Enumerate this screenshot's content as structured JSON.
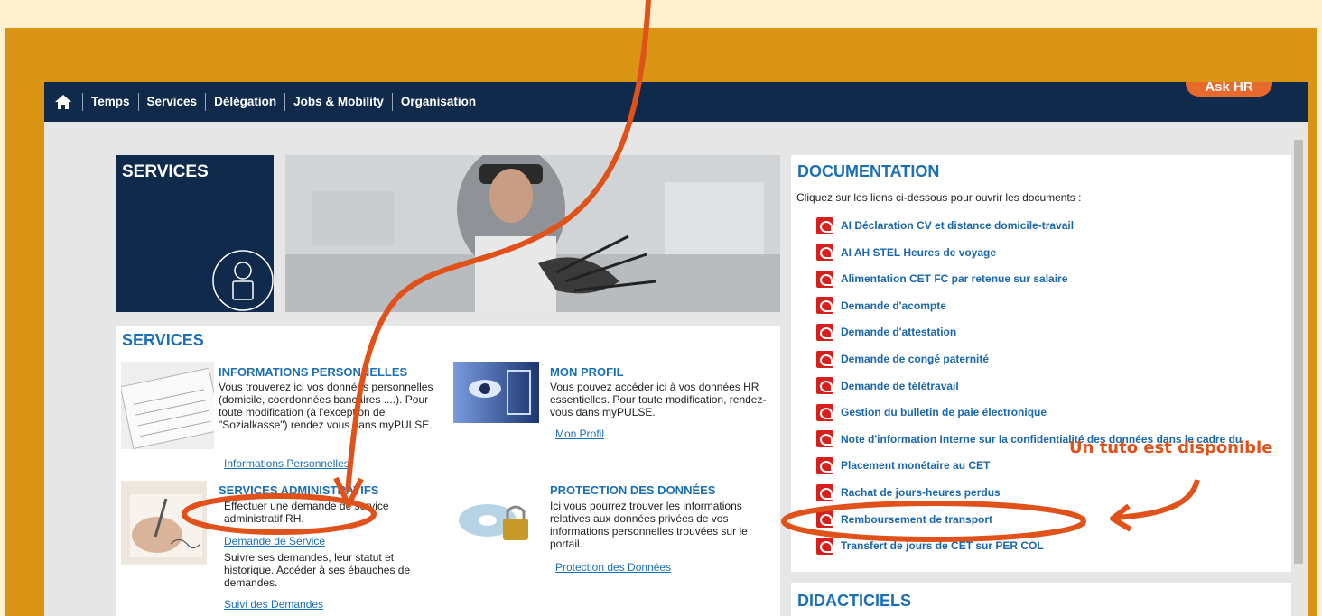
{
  "nav": {
    "items": [
      "Temps",
      "Services",
      "Délégation",
      "Jobs & Mobility",
      "Organisation"
    ],
    "askhr": "Ask HR"
  },
  "services_header": {
    "title": "SERVICES"
  },
  "services_panel": {
    "heading": "SERVICES",
    "info": {
      "title": "INFORMATIONS PERSONNELLES",
      "desc": "Vous trouverez ici vos données personnelles (domicile, coordonnées bancaires ....). Pour toute modification (à l'exception de \"Sozialkasse\") rendez vous dans myPULSE.",
      "link": "Informations Personnelles"
    },
    "profil": {
      "title": "MON PROFIL",
      "desc": "Vous pouvez accéder ici à vos données HR essentielles. Pour toute modification, rendez-vous dans myPULSE.",
      "link": "Mon Profil"
    },
    "admin": {
      "title": "SERVICES ADMINISTRATIFS",
      "desc": "Effectuer une demande de service administratif RH.",
      "link": "Demande de Service",
      "desc2": "Suivre ses demandes, leur statut et historique. Accéder à ses ébauches de demandes.",
      "link2": "Suivi des Demandes"
    },
    "protection": {
      "title": "PROTECTION DES DONNÉES",
      "desc": "Ici vous pourrez trouver les informations relatives aux données privées de vos informations personnelles trouvées sur le portail.",
      "link": "Protection des Données"
    }
  },
  "documentation": {
    "title": "DOCUMENTATION",
    "intro": "Cliquez sur les liens ci-dessous pour ouvrir les documents :",
    "items": [
      "AI Déclaration CV et distance domicile-travail",
      "AI AH STEL Heures de voyage",
      "Alimentation CET FC par retenue sur salaire",
      "Demande d'acompte",
      "Demande d'attestation",
      "Demande de congé paternité",
      "Demande de télétravail",
      "Gestion du bulletin de paie électronique",
      "Note d'information Interne sur la confidentialité des données dans le cadre du",
      "Placement monétaire au CET",
      "Rachat de jours-heures perdus",
      "Remboursement de transport",
      "Transfert de jours de CET sur PER COL"
    ]
  },
  "didacticiels": {
    "title": "DIDACTICIELS"
  },
  "annotation": {
    "text": "Un tuto est disponible"
  },
  "colors": {
    "navy": "#0f2a4b",
    "link_blue": "#1a6fb7",
    "annotation_orange": "#e0521a",
    "frame_gold": "#d89412"
  }
}
